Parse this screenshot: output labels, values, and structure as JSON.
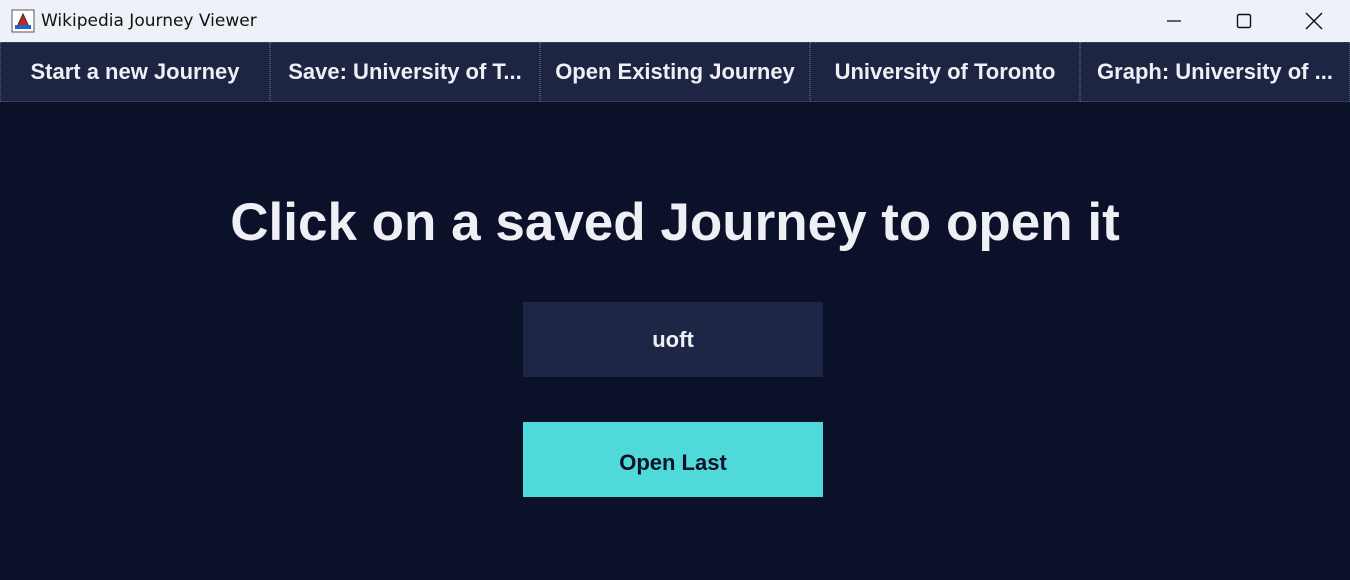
{
  "window": {
    "title": "Wikipedia Journey Viewer",
    "icon": "java-app-icon"
  },
  "tabs": [
    {
      "label": "Start a new Journey"
    },
    {
      "label": "Save: University of T..."
    },
    {
      "label": "Open Existing Journey"
    },
    {
      "label": "University of Toronto"
    },
    {
      "label": "Graph: University of ..."
    }
  ],
  "main": {
    "heading": "Click on a saved Journey to open it",
    "saved_journeys": [
      {
        "label": "uoft"
      }
    ],
    "open_last_label": "Open Last"
  },
  "colors": {
    "background": "#0b1128",
    "tab_bar": "#1d2542",
    "journey_button": "#1e2645",
    "accent": "#50d9d9",
    "text": "#eef0f6"
  }
}
